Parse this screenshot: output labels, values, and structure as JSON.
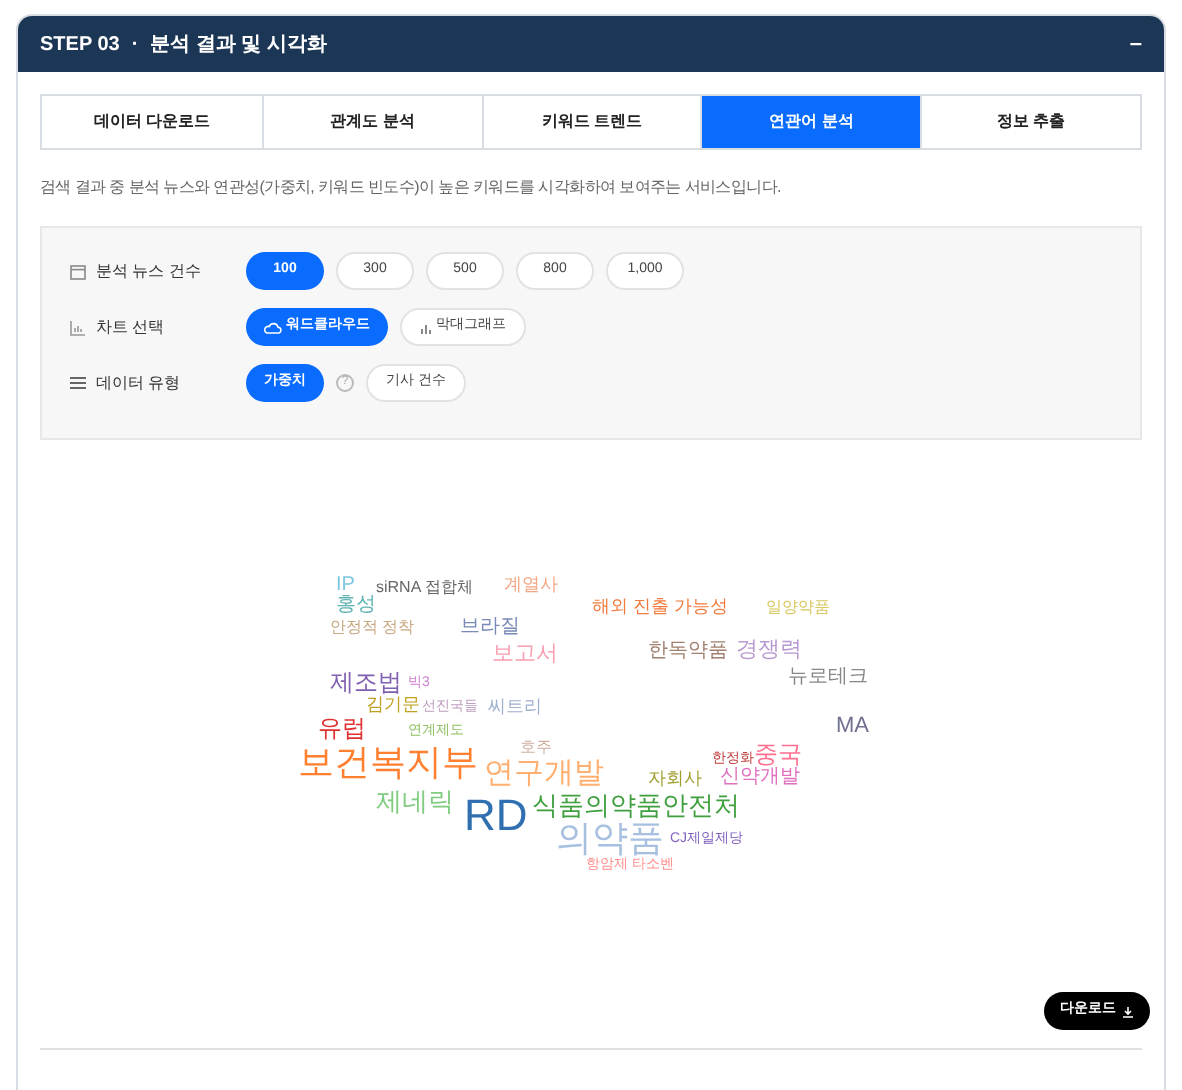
{
  "panel": {
    "step": "STEP 03",
    "separator": "·",
    "title": "분석 결과 및 시각화",
    "collapse": "–"
  },
  "tabs": [
    {
      "label": "데이터 다운로드",
      "selected": false
    },
    {
      "label": "관계도 분석",
      "selected": false
    },
    {
      "label": "키워드 트렌드",
      "selected": false
    },
    {
      "label": "연관어 분석",
      "selected": true
    },
    {
      "label": "정보 추출",
      "selected": false
    }
  ],
  "description": "검색 결과 중 분석 뉴스와 연관성(가중치, 키워드 빈도수)이 높은 키워드를 시각화하여 보여주는 서비스입니다.",
  "options": [
    {
      "label": "분석 뉴스 건수",
      "kind": "calendar",
      "choices": [
        {
          "label": "100",
          "selected": true
        },
        {
          "label": "300",
          "selected": false
        },
        {
          "label": "500",
          "selected": false
        },
        {
          "label": "800",
          "selected": false
        },
        {
          "label": "1,000",
          "selected": false
        }
      ]
    },
    {
      "label": "차트 선택",
      "kind": "chart",
      "choices": [
        {
          "label": "워드클라우드",
          "kind": "cloud",
          "selected": true
        },
        {
          "label": "막대그래프",
          "kind": "bars",
          "selected": false
        }
      ]
    },
    {
      "label": "데이터 유형",
      "kind": "list",
      "choices": [
        {
          "label": "가중치",
          "selected": true,
          "help": "?"
        },
        {
          "label": "기사 건수",
          "selected": false
        }
      ]
    }
  ],
  "word_cloud": [
    {
      "text": "IP",
      "color": "#7ec8e3"
    },
    {
      "text": "siRNA 접합체",
      "color": "#666666"
    },
    {
      "text": "계열사",
      "color": "#f4a582"
    },
    {
      "text": "홍성",
      "color": "#5fb3b3"
    },
    {
      "text": "해외 진출 가능성",
      "color": "#f07b3f"
    },
    {
      "text": "일양약품",
      "color": "#d8c860"
    },
    {
      "text": "안정적 정착",
      "color": "#c8a882"
    },
    {
      "text": "브라질",
      "color": "#7a8ab8"
    },
    {
      "text": "보고서",
      "color": "#f8a0b0"
    },
    {
      "text": "한독약품",
      "color": "#a08070"
    },
    {
      "text": "경쟁력",
      "color": "#b89ad0"
    },
    {
      "text": "제조법",
      "color": "#8060b0"
    },
    {
      "text": "빅3",
      "color": "#d080d0"
    },
    {
      "text": "뉴로테크",
      "color": "#888888"
    },
    {
      "text": "김기문",
      "color": "#c0a020"
    },
    {
      "text": "선진국들",
      "color": "#c0a0c0"
    },
    {
      "text": "씨트리",
      "color": "#a0b0d0"
    },
    {
      "text": "유럽",
      "color": "#e03030"
    },
    {
      "text": "연계제도",
      "color": "#90c060"
    },
    {
      "text": "MA",
      "color": "#707090"
    },
    {
      "text": "보건복지부",
      "color": "#ff8030"
    },
    {
      "text": "호주",
      "color": "#d0b0a0"
    },
    {
      "text": "연구개발",
      "color": "#ffb070"
    },
    {
      "text": "한정화",
      "color": "#c04040"
    },
    {
      "text": "중국",
      "color": "#ff7090"
    },
    {
      "text": "자회사",
      "color": "#a0a030"
    },
    {
      "text": "신약개발",
      "color": "#e070c0"
    },
    {
      "text": "제네릭",
      "color": "#80cc80"
    },
    {
      "text": "RD",
      "color": "#3070b0"
    },
    {
      "text": "식품의약품안전처",
      "color": "#40a040"
    },
    {
      "text": "의약품",
      "color": "#a8c0e0"
    },
    {
      "text": "CJ제일제당",
      "color": "#8060c0"
    },
    {
      "text": "항암제 타소벤",
      "color": "#ff9090"
    }
  ],
  "download": {
    "label": "다운로드"
  }
}
